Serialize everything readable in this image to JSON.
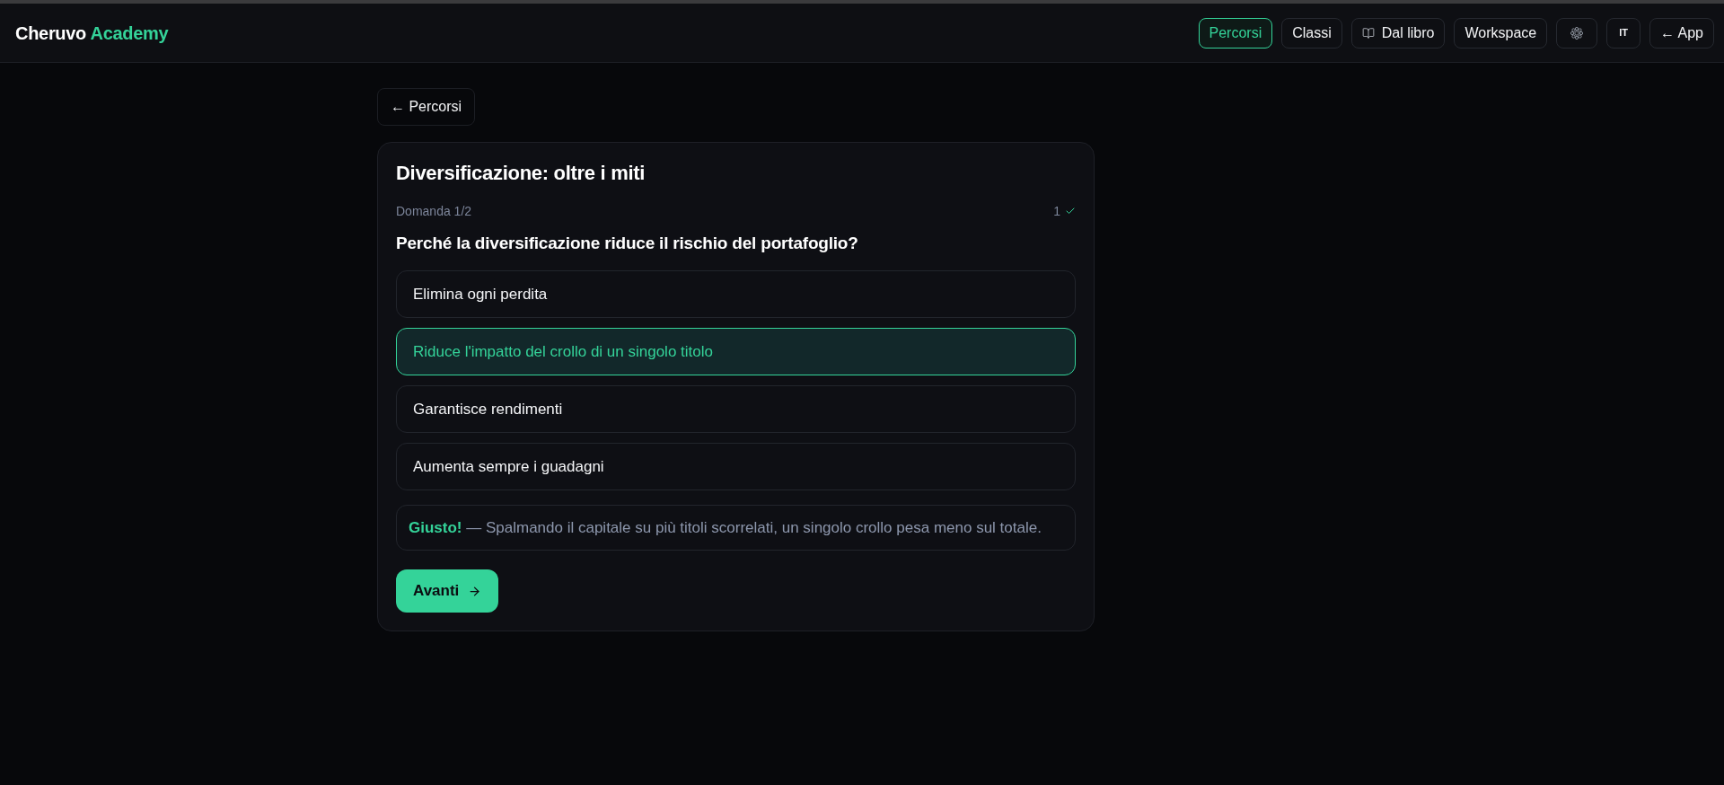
{
  "header": {
    "logo": {
      "name": "Cheruvo",
      "accent": "Academy"
    },
    "nav": [
      {
        "kind": "text",
        "label": "Percorsi",
        "selected": true
      },
      {
        "kind": "text",
        "label": "Classi",
        "selected": false
      },
      {
        "kind": "book",
        "label": "Dal libro",
        "selected": false
      },
      {
        "kind": "text",
        "label": "Workspace",
        "selected": false
      },
      {
        "kind": "settings",
        "selected": false
      },
      {
        "kind": "language",
        "label": "IT",
        "selected": false
      },
      {
        "kind": "text",
        "label": "← App",
        "selected": false
      }
    ]
  },
  "back_link": "← Percorsi",
  "quiz": {
    "title": "Diversificazione: oltre i miti",
    "progress": "Domanda 1/2",
    "score": "1",
    "question": "Perché la diversificazione riduce il rischio del portafoglio?",
    "options": [
      {
        "label": "Elimina ogni perdita",
        "selected": false
      },
      {
        "label": "Riduce l'impatto del crollo di un singolo titolo",
        "selected": true
      },
      {
        "label": "Garantisce rendimenti",
        "selected": false
      },
      {
        "label": "Aumenta sempre i guadagni",
        "selected": false
      }
    ],
    "feedback": "**Giusto!** — Spalmando il capitale su più titoli scorrelati, un singolo crollo pesa meno sul totale.",
    "next_button": "Avanti"
  }
}
